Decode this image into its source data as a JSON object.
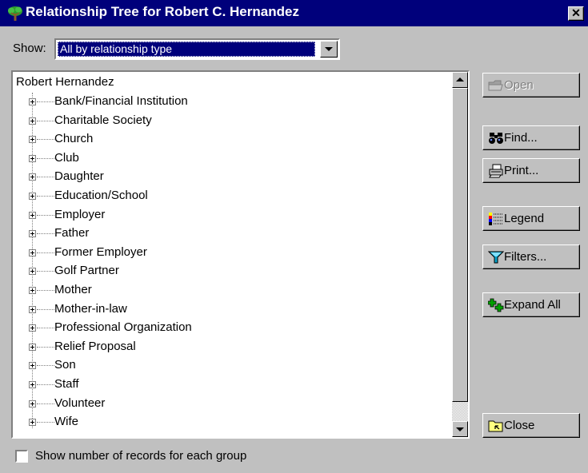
{
  "window": {
    "title": "Relationship Tree for Robert C. Hernandez",
    "close_glyph": "✕",
    "title_icon": "tree-icon"
  },
  "show": {
    "label": "Show:",
    "selected": "All by relationship type"
  },
  "tree": {
    "root": "Robert Hernandez",
    "items": [
      {
        "label": "Bank/Financial Institution"
      },
      {
        "label": "Charitable Society"
      },
      {
        "label": "Church"
      },
      {
        "label": "Club"
      },
      {
        "label": "Daughter"
      },
      {
        "label": "Education/School"
      },
      {
        "label": "Employer"
      },
      {
        "label": "Father"
      },
      {
        "label": "Former Employer"
      },
      {
        "label": "Golf Partner"
      },
      {
        "label": "Mother"
      },
      {
        "label": "Mother-in-law"
      },
      {
        "label": "Professional Organization"
      },
      {
        "label": "Relief Proposal"
      },
      {
        "label": "Son"
      },
      {
        "label": "Staff"
      },
      {
        "label": "Volunteer"
      },
      {
        "label": "Wife"
      }
    ]
  },
  "buttons": {
    "open": {
      "label": "Open",
      "icon": "folder-icon",
      "enabled": false
    },
    "find": {
      "label": "Find...",
      "icon": "binoculars-icon"
    },
    "print": {
      "label": "Print...",
      "icon": "printer-icon"
    },
    "legend": {
      "label": "Legend",
      "icon": "legend-icon"
    },
    "filters": {
      "label": "Filters...",
      "icon": "funnel-icon"
    },
    "expand_all": {
      "label": "Expand All",
      "icon": "expand-icon"
    },
    "close": {
      "label": "Close",
      "icon": "close-folder-icon"
    }
  },
  "footer": {
    "checkbox_label": "Show number of records for each group",
    "checked": false
  },
  "colors": {
    "titlebar": "#00007b",
    "face": "#c0c0c0",
    "selection": "#00007b"
  }
}
